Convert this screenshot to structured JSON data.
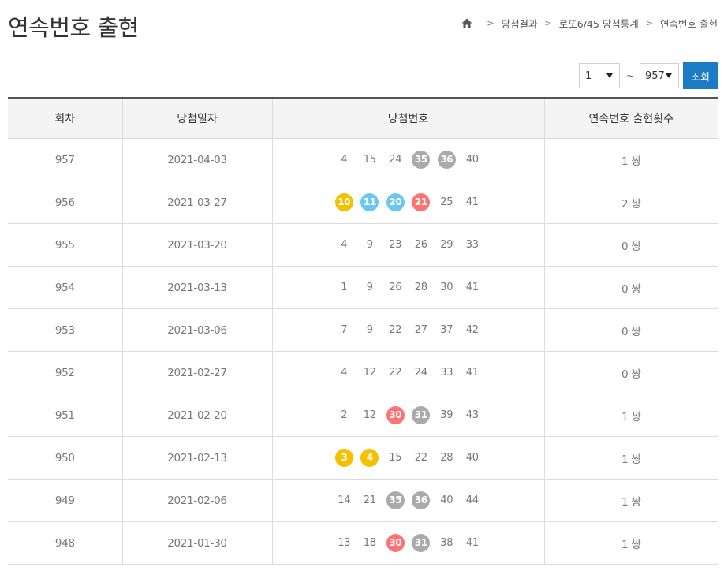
{
  "header": {
    "title": "연속번호 출현",
    "breadcrumb": [
      "당첨결과",
      "로또6/45 당첨통계",
      "연속번호 출현"
    ]
  },
  "search": {
    "from_value": "1",
    "tilde": "~",
    "to_value": "957",
    "submit_label": "조회"
  },
  "colors": {
    "yellow": "#f5c000",
    "blue": "#69c8f2",
    "red": "#ff7272",
    "gray": "#aaaaaa",
    "green": "#b0d840",
    "button": "#1b7cc5"
  },
  "table": {
    "columns": [
      "회차",
      "당첨일자",
      "당첨번호",
      "연속번호 출현횟수"
    ],
    "rows": [
      {
        "round": "957",
        "date": "2021-04-03",
        "numbers": [
          4,
          15,
          24,
          35,
          36,
          40
        ],
        "highlight": [
          false,
          false,
          false,
          true,
          true,
          false
        ],
        "count": "1 쌍"
      },
      {
        "round": "956",
        "date": "2021-03-27",
        "numbers": [
          10,
          11,
          20,
          21,
          25,
          41
        ],
        "highlight": [
          true,
          true,
          true,
          true,
          false,
          false
        ],
        "count": "2 쌍"
      },
      {
        "round": "955",
        "date": "2021-03-20",
        "numbers": [
          4,
          9,
          23,
          26,
          29,
          33
        ],
        "highlight": [
          false,
          false,
          false,
          false,
          false,
          false
        ],
        "count": "0 쌍"
      },
      {
        "round": "954",
        "date": "2021-03-13",
        "numbers": [
          1,
          9,
          26,
          28,
          30,
          41
        ],
        "highlight": [
          false,
          false,
          false,
          false,
          false,
          false
        ],
        "count": "0 쌍"
      },
      {
        "round": "953",
        "date": "2021-03-06",
        "numbers": [
          7,
          9,
          22,
          27,
          37,
          42
        ],
        "highlight": [
          false,
          false,
          false,
          false,
          false,
          false
        ],
        "count": "0 쌍"
      },
      {
        "round": "952",
        "date": "2021-02-27",
        "numbers": [
          4,
          12,
          22,
          24,
          33,
          41
        ],
        "highlight": [
          false,
          false,
          false,
          false,
          false,
          false
        ],
        "count": "0 쌍"
      },
      {
        "round": "951",
        "date": "2021-02-20",
        "numbers": [
          2,
          12,
          30,
          31,
          39,
          43
        ],
        "highlight": [
          false,
          false,
          true,
          true,
          false,
          false
        ],
        "count": "1 쌍"
      },
      {
        "round": "950",
        "date": "2021-02-13",
        "numbers": [
          3,
          4,
          15,
          22,
          28,
          40
        ],
        "highlight": [
          true,
          true,
          false,
          false,
          false,
          false
        ],
        "count": "1 쌍"
      },
      {
        "round": "949",
        "date": "2021-02-06",
        "numbers": [
          14,
          21,
          35,
          36,
          40,
          44
        ],
        "highlight": [
          false,
          false,
          true,
          true,
          false,
          false
        ],
        "count": "1 쌍"
      },
      {
        "round": "948",
        "date": "2021-01-30",
        "numbers": [
          13,
          18,
          30,
          31,
          38,
          41
        ],
        "highlight": [
          false,
          false,
          true,
          true,
          false,
          false
        ],
        "count": "1 쌍"
      }
    ]
  }
}
